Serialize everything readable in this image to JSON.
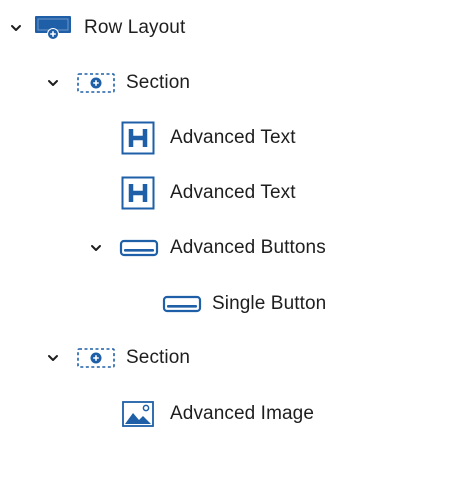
{
  "tree": {
    "items": [
      {
        "label": "Row Layout",
        "icon": "row-layout-icon",
        "expanded": true
      },
      {
        "label": "Section",
        "icon": "section-icon",
        "expanded": true
      },
      {
        "label": "Advanced Text",
        "icon": "heading-icon"
      },
      {
        "label": "Advanced Text",
        "icon": "heading-icon"
      },
      {
        "label": "Advanced Buttons",
        "icon": "buttons-icon",
        "expanded": true
      },
      {
        "label": "Single Button",
        "icon": "button-icon"
      },
      {
        "label": "Section",
        "icon": "section-icon",
        "expanded": true
      },
      {
        "label": "Advanced Image",
        "icon": "image-icon"
      }
    ]
  },
  "colors": {
    "accent": "#1e5fa8",
    "text": "#1e1e1e"
  }
}
